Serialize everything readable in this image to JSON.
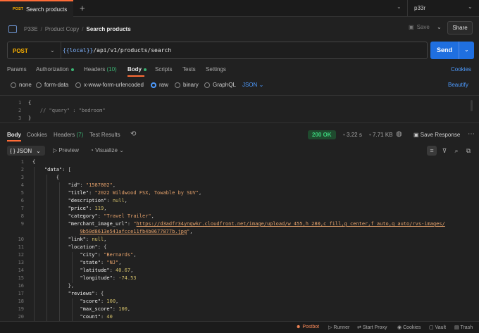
{
  "tab": {
    "method": "POST",
    "name": "Search products"
  },
  "env": {
    "name": "p33r"
  },
  "breadcrumb": {
    "workspace": "P33E",
    "collection": "Product Copy",
    "current": "Search products"
  },
  "toolbar": {
    "save_label": "Save",
    "share_label": "Share"
  },
  "request": {
    "method": "POST",
    "url_var": "{{local}}",
    "url_path": "/api/v1/products/search",
    "send_label": "Send"
  },
  "req_tabs": {
    "params": "Params",
    "authorization": "Authorization",
    "headers": "Headers",
    "headers_count": "(10)",
    "body": "Body",
    "scripts": "Scripts",
    "tests": "Tests",
    "settings": "Settings",
    "cookies": "Cookies"
  },
  "body_types": {
    "none": "none",
    "form_data": "form-data",
    "urlencoded": "x-www-form-urlencoded",
    "raw": "raw",
    "binary": "binary",
    "graphql": "GraphQL",
    "json": "JSON",
    "beautify": "Beautify"
  },
  "editor": {
    "lines": [
      {
        "n": "1",
        "code": "{"
      },
      {
        "n": "2",
        "code": "    // \"query\" : \"bedroom\""
      },
      {
        "n": "3",
        "code": "}"
      }
    ]
  },
  "resp_tabs": {
    "body": "Body",
    "cookies": "Cookies",
    "headers": "Headers",
    "headers_count": "(7)",
    "test_results": "Test Results"
  },
  "resp_meta": {
    "status": "200 OK",
    "time": "3.22 s",
    "size": "7.71 KB",
    "save_response": "Save Response"
  },
  "resp_toolbar": {
    "format": "{ } JSON",
    "preview": "Preview",
    "visualize": "Visualize"
  },
  "response": {
    "id": "1587802",
    "title": "2022 Wildwood FSX, Towable by SUV",
    "description": "null",
    "price": "119",
    "category": "Travel Trailer",
    "image_url_1": "https://d3adfr34ynqwkr.cloudfront.net/image/upload/w_455,h_280,c_fill,g_center,f_auto,q_auto/rvs-images/",
    "image_url_2": "9b50d8613e541afcce11fb4b0677877b.jpg",
    "link": "null",
    "city": "Bernards",
    "state": "NJ",
    "latitude": "40.67",
    "longitude": "-74.53",
    "score": "100",
    "max_score": "100",
    "count": "40"
  },
  "footer": {
    "postbot": "Postbot",
    "runner": "Runner",
    "proxy": "Start Proxy",
    "cookies": "Cookies",
    "vault": "Vault",
    "trash": "Trash"
  },
  "colors": {
    "accent": "#ff6c37",
    "send": "#1f6fe0",
    "ok": "#3bd07a"
  }
}
